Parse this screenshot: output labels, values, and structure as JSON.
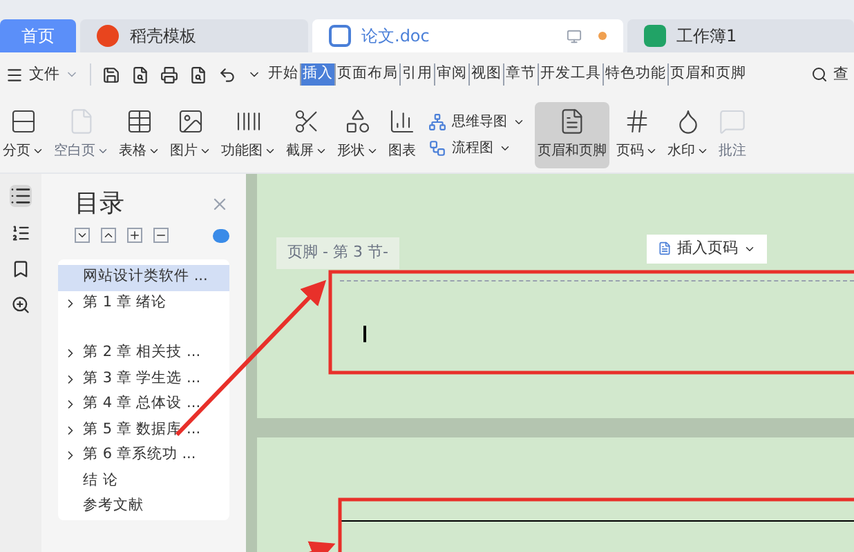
{
  "tabs": [
    {
      "label": "首页",
      "kind": "home",
      "selected": false
    },
    {
      "label": "稻壳模板",
      "kind": "docer",
      "selected": false
    },
    {
      "label": "论文.doc",
      "kind": "word",
      "selected": true
    },
    {
      "label": "工作簿1",
      "kind": "sheet",
      "selected": false
    }
  ],
  "menu": {
    "file": "文件",
    "ribbon_tabs": [
      {
        "label": "开始",
        "selected": false
      },
      {
        "label": "插入",
        "selected": true
      },
      {
        "label": "页面布局",
        "selected": false
      },
      {
        "label": "引用",
        "selected": false
      },
      {
        "label": "审阅",
        "selected": false
      },
      {
        "label": "视图",
        "selected": false
      },
      {
        "label": "章节",
        "selected": false
      },
      {
        "label": "开发工具",
        "selected": false
      },
      {
        "label": "特色功能",
        "selected": false
      },
      {
        "label": "页眉和页脚",
        "selected": false
      }
    ],
    "search": "查"
  },
  "toolbar": [
    {
      "kind": "big",
      "label": "分页",
      "dropdown": true,
      "disabled": false,
      "selected": false
    },
    {
      "kind": "big",
      "label": "空白页",
      "dropdown": true,
      "disabled": true,
      "selected": false
    },
    {
      "kind": "big",
      "label": "表格",
      "dropdown": true,
      "disabled": false,
      "selected": false
    },
    {
      "kind": "big",
      "label": "图片",
      "dropdown": true,
      "disabled": false,
      "selected": false
    },
    {
      "kind": "big",
      "label": "功能图",
      "dropdown": true,
      "disabled": false,
      "selected": false
    },
    {
      "kind": "big",
      "label": "截屏",
      "dropdown": true,
      "disabled": false,
      "selected": false
    },
    {
      "kind": "big",
      "label": "形状",
      "dropdown": true,
      "disabled": false,
      "selected": false
    },
    {
      "kind": "big",
      "label": "图表",
      "dropdown": false,
      "disabled": false,
      "selected": false
    },
    {
      "kind": "small",
      "label": "思维导图",
      "dropdown": true,
      "disabled": false,
      "selected": false
    },
    {
      "kind": "small",
      "label": "流程图",
      "dropdown": true,
      "disabled": false,
      "selected": false
    },
    {
      "kind": "big",
      "label": "页眉和页脚",
      "dropdown": false,
      "disabled": false,
      "selected": true
    },
    {
      "kind": "big",
      "label": "页码",
      "dropdown": true,
      "disabled": false,
      "selected": false
    },
    {
      "kind": "big",
      "label": "水印",
      "dropdown": true,
      "disabled": false,
      "selected": false
    },
    {
      "kind": "big",
      "label": "批注",
      "dropdown": false,
      "disabled": true,
      "selected": false
    }
  ],
  "toc": {
    "title": "目录",
    "items": [
      {
        "label": "网站设计类软件 ...",
        "kind": "plain",
        "selected": true
      },
      {
        "label": "第 1 章  绪论",
        "kind": "chapter",
        "selected": false
      },
      {
        "label": "第 2 章  相关技 ...",
        "kind": "chapter",
        "selected": false
      },
      {
        "label": "第 3 章  学生选 ...",
        "kind": "chapter",
        "selected": false
      },
      {
        "label": "第 4 章  总体设 ...",
        "kind": "chapter",
        "selected": false
      },
      {
        "label": "第 5 章  数据库 ...",
        "kind": "chapter",
        "selected": false
      },
      {
        "label": "第 6 章系统功 ...",
        "kind": "chapter",
        "selected": false
      },
      {
        "label": "结      论",
        "kind": "plain",
        "selected": false
      },
      {
        "label": "参考文献",
        "kind": "plain",
        "selected": false
      }
    ]
  },
  "document": {
    "footer_label": "页脚 - 第 3 节-",
    "insert_page_number": "插入页码"
  }
}
